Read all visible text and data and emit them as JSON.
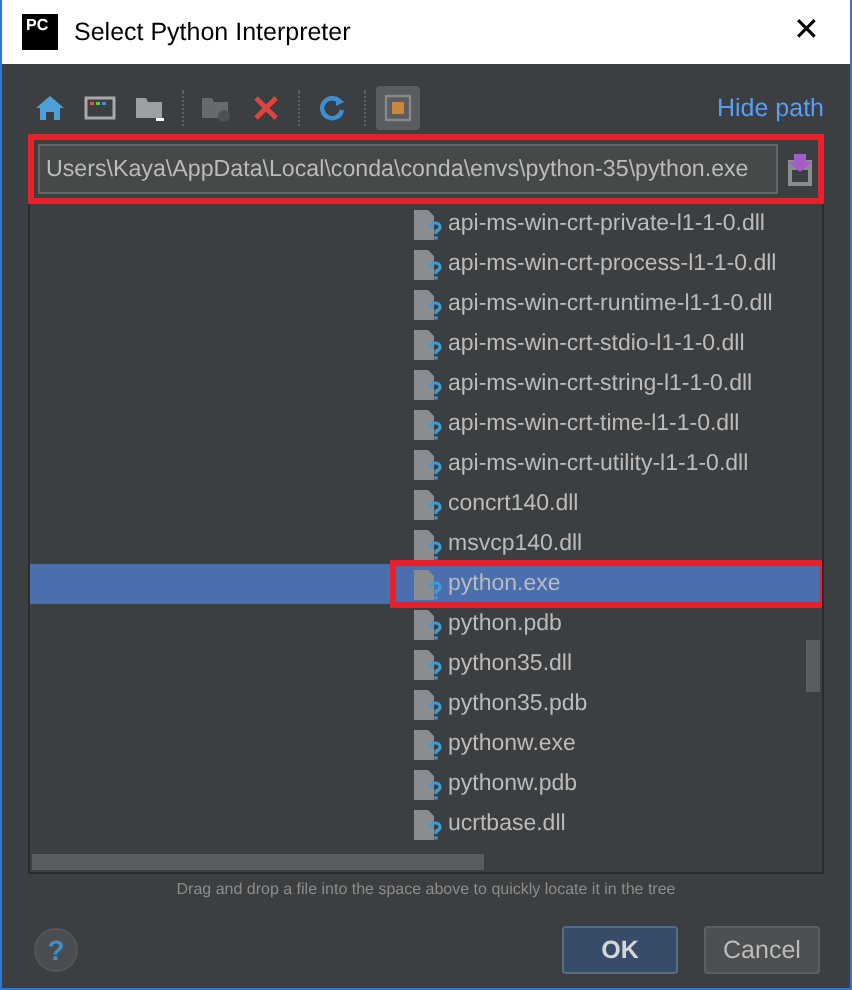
{
  "window": {
    "title": "Select Python Interpreter",
    "app_badge": "PC",
    "close": "✕"
  },
  "toolbar": [
    {
      "kind": "home",
      "disabled": false,
      "selected": false
    },
    {
      "kind": "desktop",
      "disabled": false,
      "selected": false
    },
    {
      "kind": "folder",
      "disabled": false,
      "selected": false
    },
    {
      "kind": "new-folder",
      "disabled": true,
      "selected": false
    },
    {
      "kind": "delete",
      "disabled": false,
      "selected": false
    },
    {
      "kind": "refresh",
      "disabled": false,
      "selected": false
    },
    {
      "kind": "toggle",
      "disabled": false,
      "selected": true
    }
  ],
  "hide_path": "Hide path",
  "path_field": {
    "value": "Users\\Kaya\\AppData\\Local\\conda\\conda\\envs\\python-35\\python.exe",
    "highlighted": true
  },
  "tree": [
    {
      "name": "api-ms-win-crt-private-l1-1-0.dll",
      "selected": false,
      "highlighted": false
    },
    {
      "name": "api-ms-win-crt-process-l1-1-0.dll",
      "selected": false,
      "highlighted": false
    },
    {
      "name": "api-ms-win-crt-runtime-l1-1-0.dll",
      "selected": false,
      "highlighted": false
    },
    {
      "name": "api-ms-win-crt-stdio-l1-1-0.dll",
      "selected": false,
      "highlighted": false
    },
    {
      "name": "api-ms-win-crt-string-l1-1-0.dll",
      "selected": false,
      "highlighted": false
    },
    {
      "name": "api-ms-win-crt-time-l1-1-0.dll",
      "selected": false,
      "highlighted": false
    },
    {
      "name": "api-ms-win-crt-utility-l1-1-0.dll",
      "selected": false,
      "highlighted": false
    },
    {
      "name": "concrt140.dll",
      "selected": false,
      "highlighted": false
    },
    {
      "name": "msvcp140.dll",
      "selected": false,
      "highlighted": false
    },
    {
      "name": "python.exe",
      "selected": true,
      "highlighted": true
    },
    {
      "name": "python.pdb",
      "selected": false,
      "highlighted": false
    },
    {
      "name": "python35.dll",
      "selected": false,
      "highlighted": false
    },
    {
      "name": "python35.pdb",
      "selected": false,
      "highlighted": false
    },
    {
      "name": "pythonw.exe",
      "selected": false,
      "highlighted": false
    },
    {
      "name": "pythonw.pdb",
      "selected": false,
      "highlighted": false
    },
    {
      "name": "ucrtbase.dll",
      "selected": false,
      "highlighted": false
    }
  ],
  "hint": "Drag and drop a file into the space above to quickly locate it in the tree",
  "help": "?",
  "buttons": [
    {
      "label": "OK",
      "kind": "default"
    },
    {
      "label": "Cancel",
      "kind": "normal"
    }
  ]
}
